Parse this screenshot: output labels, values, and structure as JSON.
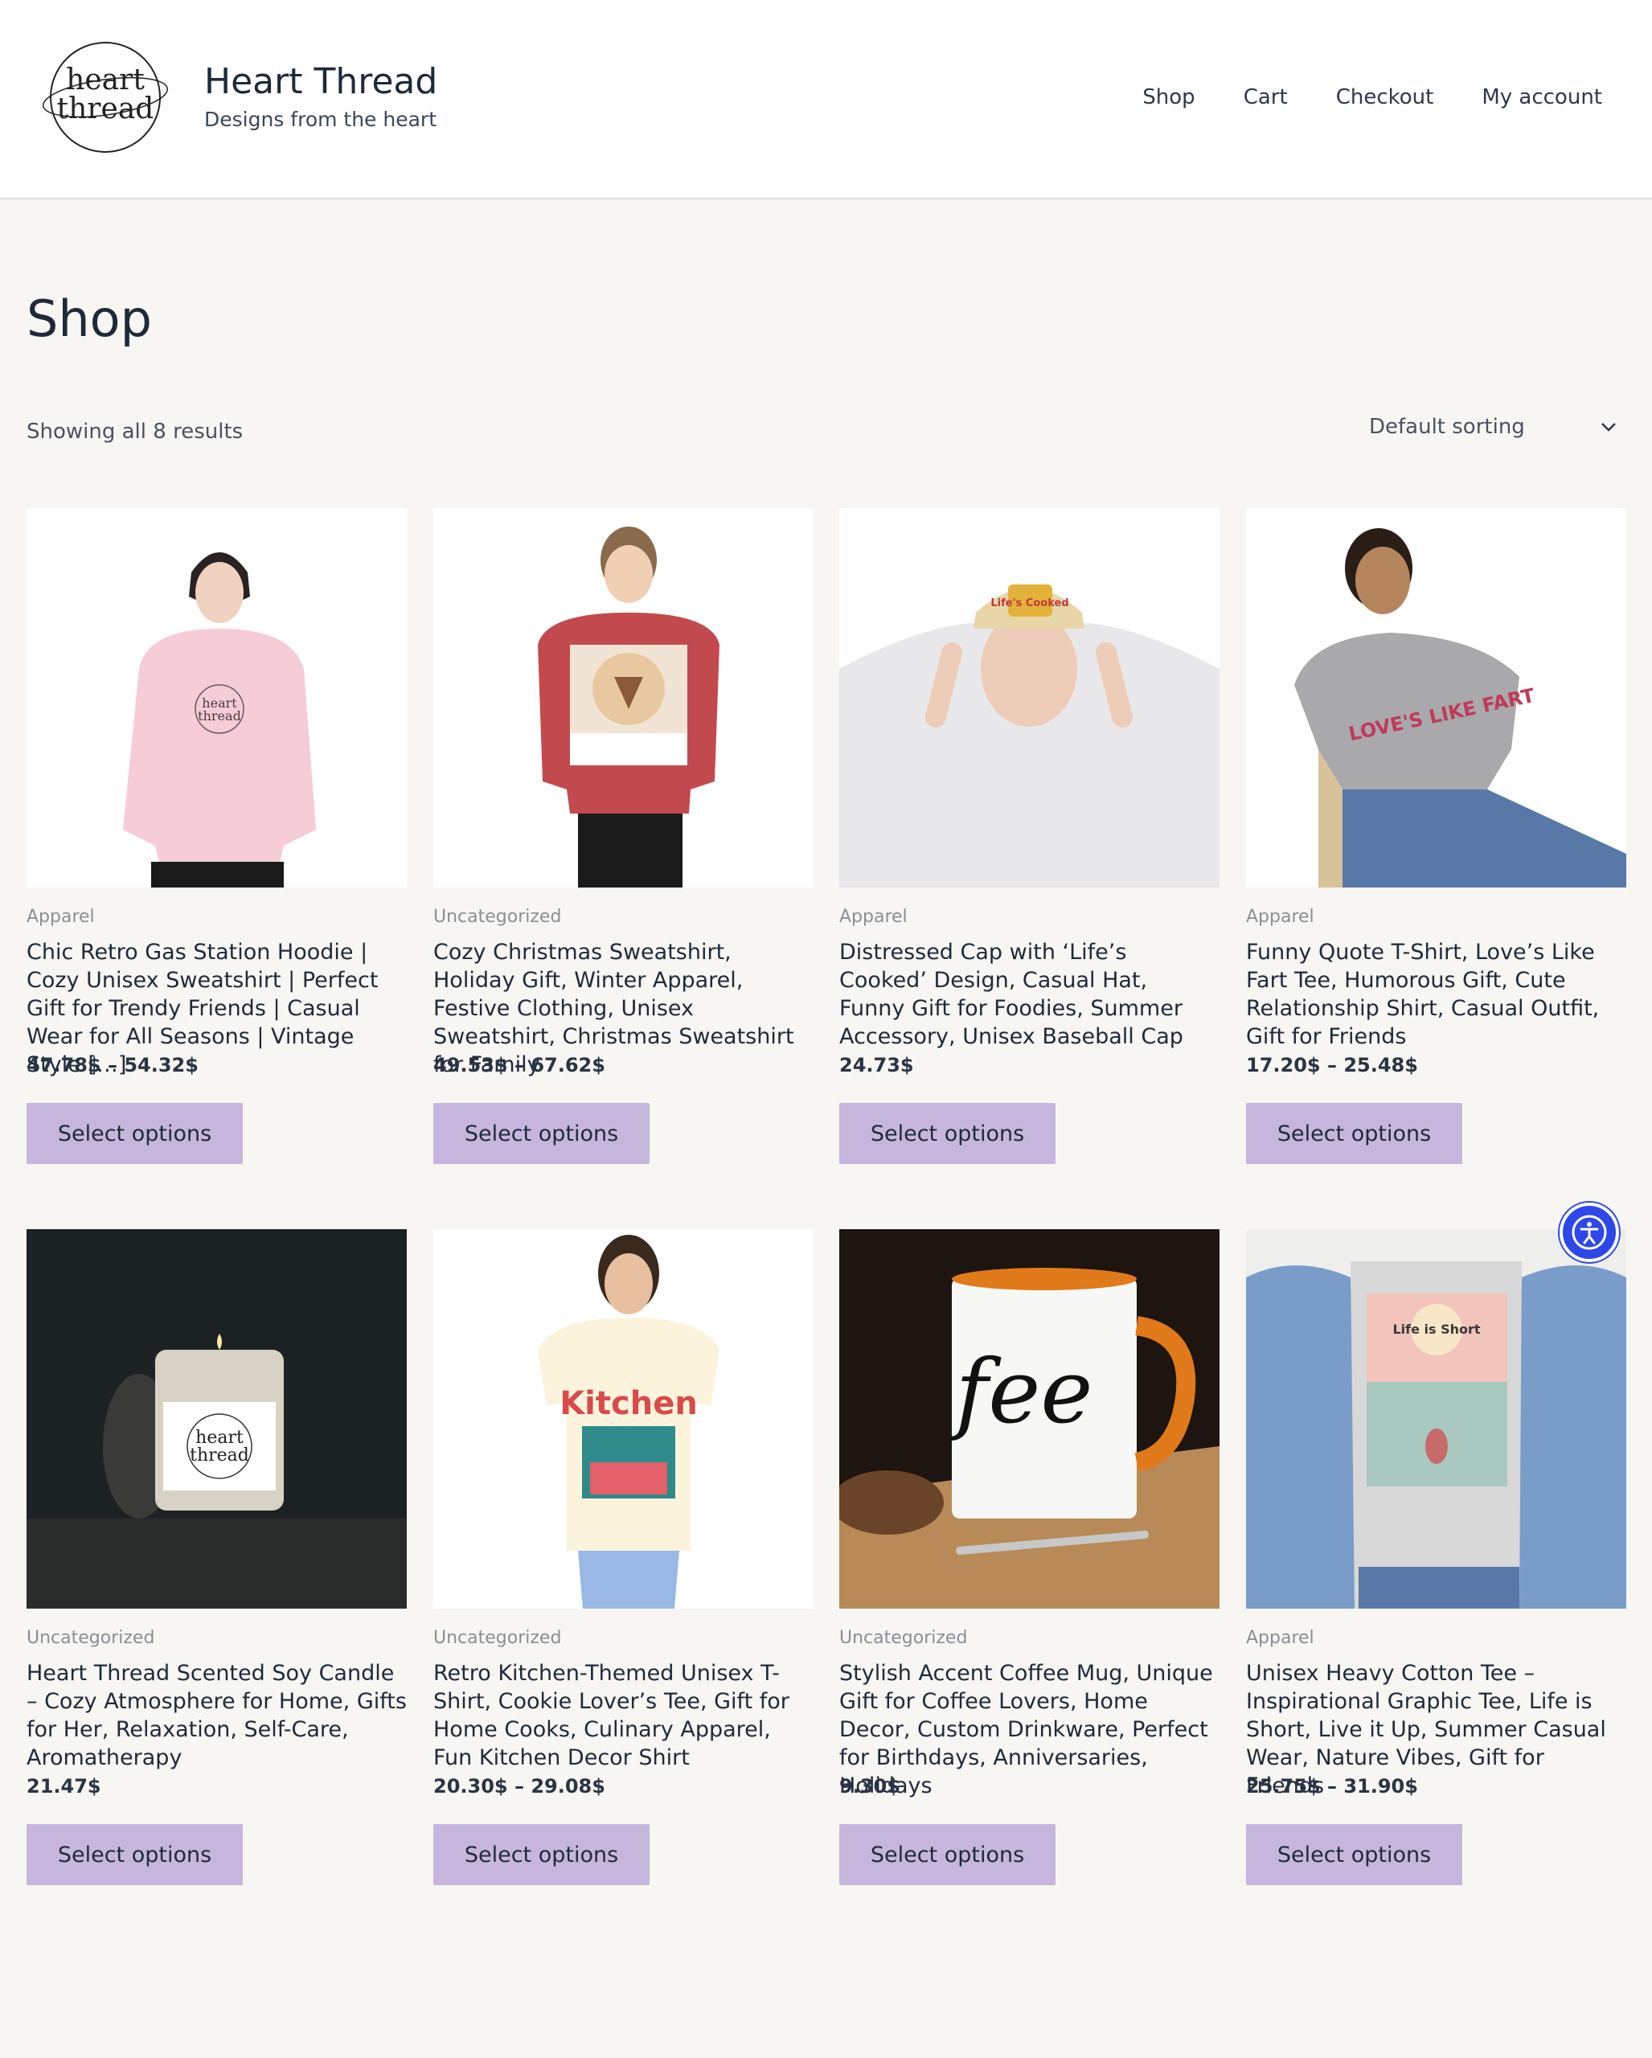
{
  "header": {
    "logo_text": "heart thread",
    "site_title": "Heart Thread",
    "tagline": "Designs from the heart",
    "nav": [
      "Shop",
      "Cart",
      "Checkout",
      "My account"
    ]
  },
  "page": {
    "title": "Shop",
    "results": "Showing all 8 results",
    "sorting": "Default sorting"
  },
  "products": [
    {
      "category": "Apparel",
      "title": "Chic Retro Gas Station Hoodie | Cozy Unisex Sweatshirt | Perfect Gift for Trendy Friends | Casual Wear for All Seasons | Vintage Style […]",
      "price": "47.78$ – 54.32$",
      "button": "Select options",
      "image": "hoodie-photo"
    },
    {
      "category": "Uncategorized",
      "title": "Cozy Christmas Sweatshirt, Holiday Gift, Winter Apparel, Festive Clothing, Unisex Sweatshirt, Christmas Sweatshirt for Family",
      "price": "49.53$ – 67.62$",
      "button": "Select options",
      "image": "christmas-sweatshirt-photo"
    },
    {
      "category": "Apparel",
      "title": "Distressed Cap with ‘Life’s Cooked’ Design, Casual Hat, Funny Gift for Foodies, Summer Accessory, Unisex Baseball Cap",
      "price": "24.73$",
      "button": "Select options",
      "image": "cap-photo"
    },
    {
      "category": "Apparel",
      "title": "Funny Quote T-Shirt, Love’s Like Fart Tee, Humorous Gift, Cute Relationship Shirt, Casual Outfit, Gift for Friends",
      "price": "17.20$ – 25.48$",
      "button": "Select options",
      "image": "tshirt-photo"
    },
    {
      "category": "Uncategorized",
      "title": "Heart Thread Scented Soy Candle – Cozy Atmosphere for Home, Gifts for Her, Relaxation, Self-Care, Aromatherapy",
      "price": "21.47$",
      "button": "Select options",
      "image": "candle-photo"
    },
    {
      "category": "Uncategorized",
      "title": "Retro Kitchen-Themed Unisex T-Shirt, Cookie Lover’s Tee, Gift for Home Cooks, Culinary Apparel, Fun Kitchen Decor Shirt",
      "price": "20.30$ – 29.08$",
      "button": "Select options",
      "image": "kitchen-tee-photo"
    },
    {
      "category": "Uncategorized",
      "title": "Stylish Accent Coffee Mug, Unique Gift for Coffee Lovers, Home Decor, Custom Drinkware, Perfect for Birthdays, Anniversaries, Holidays",
      "price": "9.30$",
      "button": "Select options",
      "image": "mug-photo"
    },
    {
      "category": "Apparel",
      "title": "Unisex Heavy Cotton Tee – Inspirational Graphic Tee, Life is Short, Live it Up, Summer Casual Wear, Nature Vibes, Gift for Friends",
      "price": "25.75$ – 31.90$",
      "button": "Select options",
      "image": "heavy-tee-photo"
    }
  ],
  "image_texts": {
    "cap": "Life's Cooked",
    "tshirt": "LOVE'S LIKE FART",
    "kitchen": "Kitchen",
    "mug": "fee",
    "heavy_tee": "Life is Short"
  },
  "colors": {
    "background": "#f7f6f2",
    "button": "#c6b6de",
    "accessibility": "#2e47e8"
  }
}
